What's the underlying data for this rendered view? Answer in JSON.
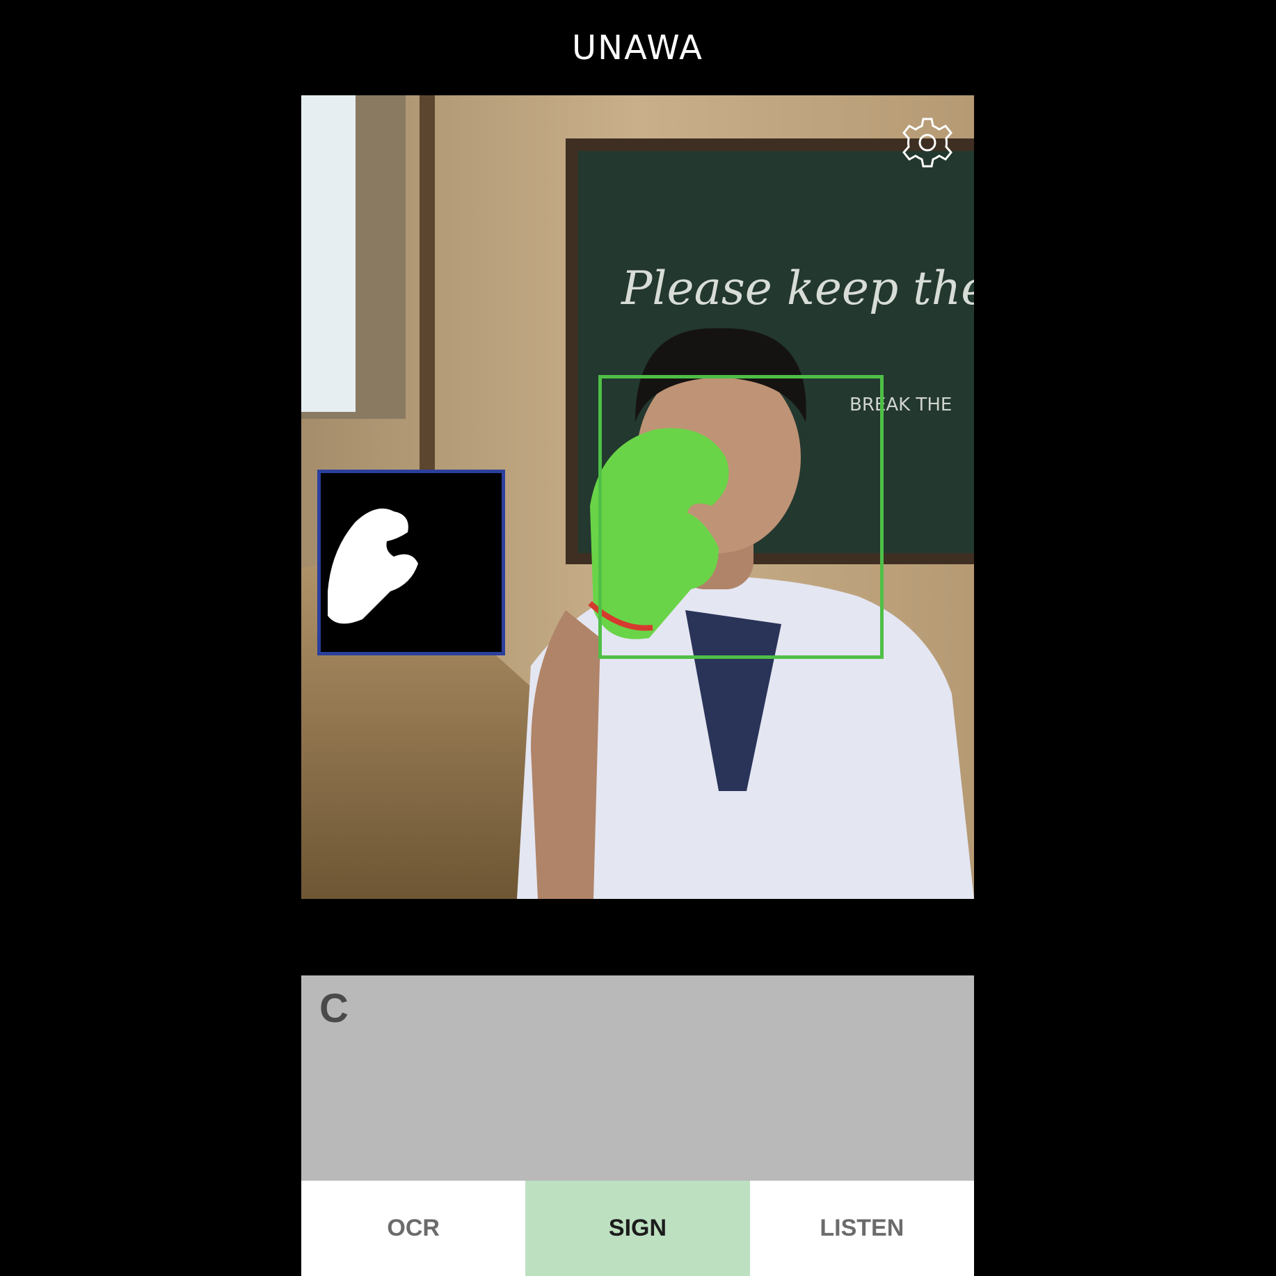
{
  "app": {
    "title": "UNAWA"
  },
  "camera": {
    "chalkboard_lines": [
      "Please keep the",
      "BREAK THE"
    ],
    "settings_icon": "gear-icon",
    "detection_box_color": "#4fbf47",
    "mask_box_color": "#2b3f9c"
  },
  "output": {
    "text": "C"
  },
  "tabs": [
    {
      "label": "OCR",
      "active": false
    },
    {
      "label": "SIGN",
      "active": true
    },
    {
      "label": "LISTEN",
      "active": false
    }
  ],
  "colors": {
    "active_tab": "#bde0c1",
    "output_bg": "#b9b9b9"
  }
}
